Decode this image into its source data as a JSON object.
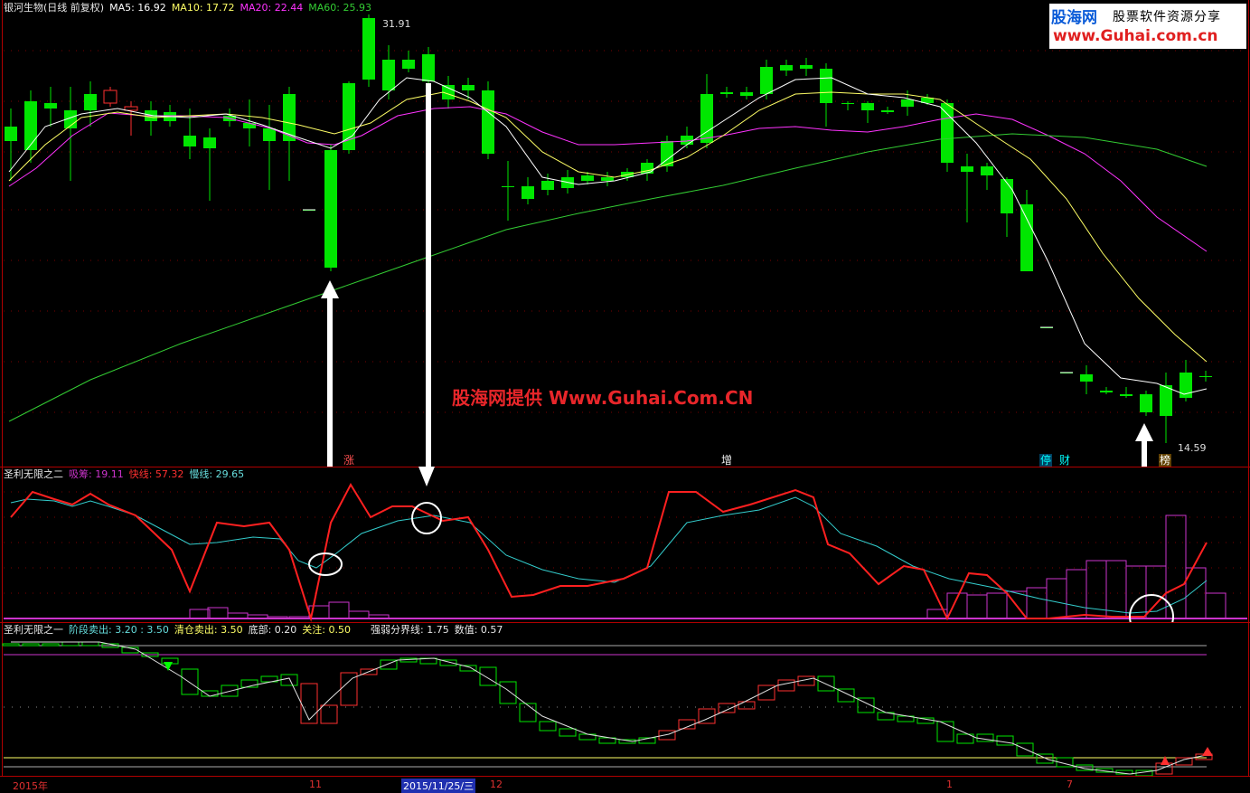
{
  "main_header": {
    "stock": "银河生物(日线 前复权)",
    "ma5": "MA5: 16.92",
    "ma10": "MA10: 17.72",
    "ma20": "MA20: 22.44",
    "ma60": "MA60: 25.93"
  },
  "price_labels": {
    "high": "31.91",
    "low": "14.59"
  },
  "watermark": "股海网提供 Www.Guhai.Com.CN",
  "logo": {
    "name": "股海网",
    "slogan": "股票软件资源分享",
    "url": "www.Guhai.com.cn"
  },
  "events": [
    "涨",
    "增",
    "停",
    "财",
    "榜"
  ],
  "ind2_header": {
    "title": "圣利无限之二",
    "absorb": "吸筹: 19.11",
    "fast": "快线: 57.32",
    "slow": "慢线: 29.65"
  },
  "ind1_header": {
    "title": "圣利无限之一",
    "stage": "阶段卖出: 3.20 : 3.50",
    "clear": "清仓卖出: 3.50",
    "bottom": "底部: 0.20",
    "watch": "关注: 0.50",
    "boundary": "强弱分界线: 1.75",
    "value": "数值: 0.57"
  },
  "timebar": {
    "year": "2015年",
    "m11": "11",
    "date": "2015/11/25/三",
    "m12": "12",
    "m1": "1",
    "m7": "7"
  },
  "colors": {
    "up": "#ff3030",
    "down": "#00e600",
    "ma5": "#ffffff",
    "ma10": "#ffff66",
    "ma20": "#ff33ff",
    "ma60": "#33cc33",
    "fast": "#ff2020",
    "slow": "#33cccc",
    "absorb": "#cc33cc",
    "frame": "#b00000"
  },
  "chart_data": {
    "type": "candlestick",
    "ma_values": {
      "MA5": 16.92,
      "MA10": 17.72,
      "MA20": 22.44,
      "MA60": 25.93
    },
    "high": 31.91,
    "low": 14.59,
    "indicator2": {
      "吸筹": 19.11,
      "快线": 57.32,
      "慢线": 29.65
    },
    "indicator1": {
      "阶段卖出": [
        3.2,
        3.5
      ],
      "清仓卖出": 3.5,
      "底部": 0.2,
      "关注": 0.5,
      "强弱分界线": 1.75,
      "数值": 0.57
    }
  }
}
